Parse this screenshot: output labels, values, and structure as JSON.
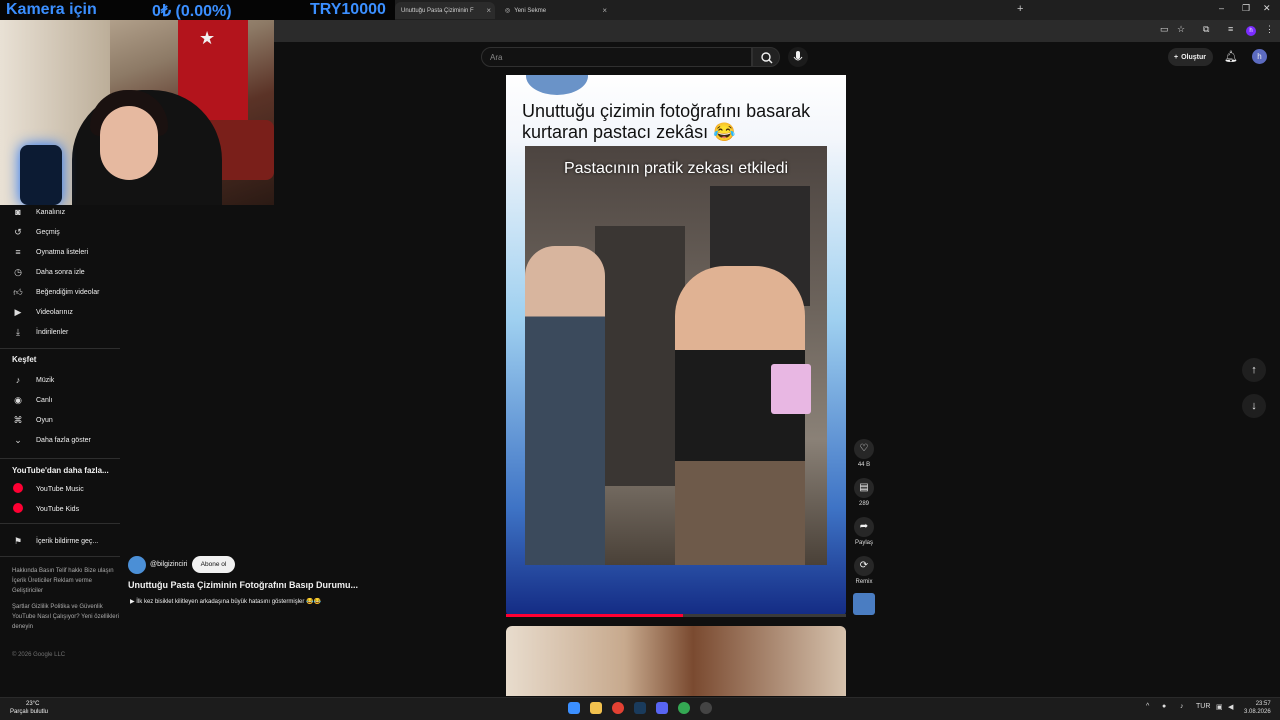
{
  "overlay": {
    "camera_label": "Kamera için",
    "price": "0₺ (0.00%)",
    "goal": "TRY10000"
  },
  "browser": {
    "tabs": [
      {
        "label": "Unuttuğu Pasta Çiziminin F"
      },
      {
        "label": "Yeni Sekme"
      }
    ],
    "profile_letter": "h"
  },
  "header": {
    "search_placeholder": "Ara",
    "create_label": "Oluştur",
    "avatar_letter": "h"
  },
  "sidebar": {
    "you_items": [
      {
        "label": "Kanalınız",
        "icon": "channel-icon"
      },
      {
        "label": "Geçmiş",
        "icon": "history-icon"
      },
      {
        "label": "Oynatma listeleri",
        "icon": "playlist-icon"
      },
      {
        "label": "Daha sonra izle",
        "icon": "clock-icon"
      },
      {
        "label": "Beğendiğim videolar",
        "icon": "thumb-up-icon"
      },
      {
        "label": "Videolarınız",
        "icon": "video-icon"
      },
      {
        "label": "İndirilenler",
        "icon": "download-icon"
      }
    ],
    "explore_title": "Keşfet",
    "explore_items": [
      {
        "label": "Müzik",
        "icon": "music-icon"
      },
      {
        "label": "Canlı",
        "icon": "live-icon"
      },
      {
        "label": "Oyun",
        "icon": "gaming-icon"
      },
      {
        "label": "Daha fazla göster",
        "icon": "chevron-down-icon"
      }
    ],
    "more_title": "YouTube'dan daha fazla...",
    "more_items": [
      {
        "label": "YouTube Music"
      },
      {
        "label": "YouTube Kids"
      }
    ],
    "report_label": "İçerik bildirme geç...",
    "footer1": "Hakkında  Basın  Telif hakkı  Bize ulaşın  İçerik Üreticiler  Reklam verme  Geliştiriciler",
    "footer2": "Şartlar  Gizlilik  Politika ve Güvenlik  YouTube Nasıl Çalışıyor?  Yeni özellikleri deneyin",
    "copyright": "© 2026 Google LLC"
  },
  "short": {
    "caption": "Unuttuğu çizimin fotoğrafını basarak kurtaran pastacı zekâsı 😂",
    "video_text": "Pastacının pratik zekası etkiledi",
    "progress": 0.52,
    "like_count": "44 B",
    "comment_count": "289",
    "share_label": "Paylaş",
    "remix_label": "Remix",
    "channel": "@bilgizinciri",
    "subscribe_label": "Abone ol",
    "title": "Unuttuğu Pasta Çiziminin Fotoğrafını Basıp Durumu...",
    "subtitle": "İlk kez bisiklet kilitleyen arkadaşına büyük hatasını göstermişler 😂😂"
  },
  "taskbar": {
    "temperature": "23°C",
    "weather": "Parçalı bulutlu",
    "lang": "TUR",
    "time": "23:57",
    "date": "3.08.2026"
  }
}
